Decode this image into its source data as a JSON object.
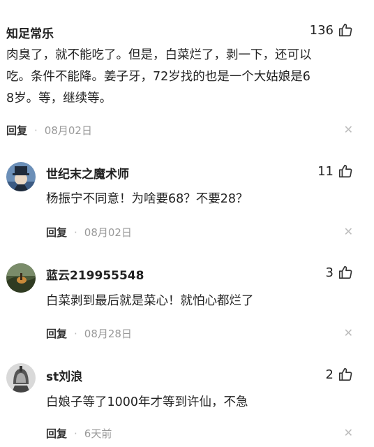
{
  "comments": [
    {
      "name": "知足常乐",
      "likes": "136",
      "lines": [
        "肉臭了，就不能吃了。但是，白菜烂了，剥一下，还可以",
        "吃。条件不能降。姜子牙，72岁找的也是一个大姑娘是6",
        "8岁。等，继续等。"
      ],
      "reply": "回复",
      "date": "08月02日",
      "close": "✕"
    },
    {
      "name": "世纪末之魔术师",
      "likes": "11",
      "text": "杨振宁不同意！为啥要68？不要28？",
      "reply": "回复",
      "date": "08月02日",
      "close": "✕"
    },
    {
      "name": "蓝云219955548",
      "likes": "3",
      "text": "白菜剥到最后就是菜心！就怕心都烂了",
      "reply": "回复",
      "date": "08月28日",
      "close": "✕"
    },
    {
      "name": "st刘浪",
      "likes": "2",
      "text": "白娘子等了1000年才等到许仙，不急",
      "reply": "回复",
      "date": "6天前",
      "close": "✕"
    }
  ],
  "dot": "·"
}
